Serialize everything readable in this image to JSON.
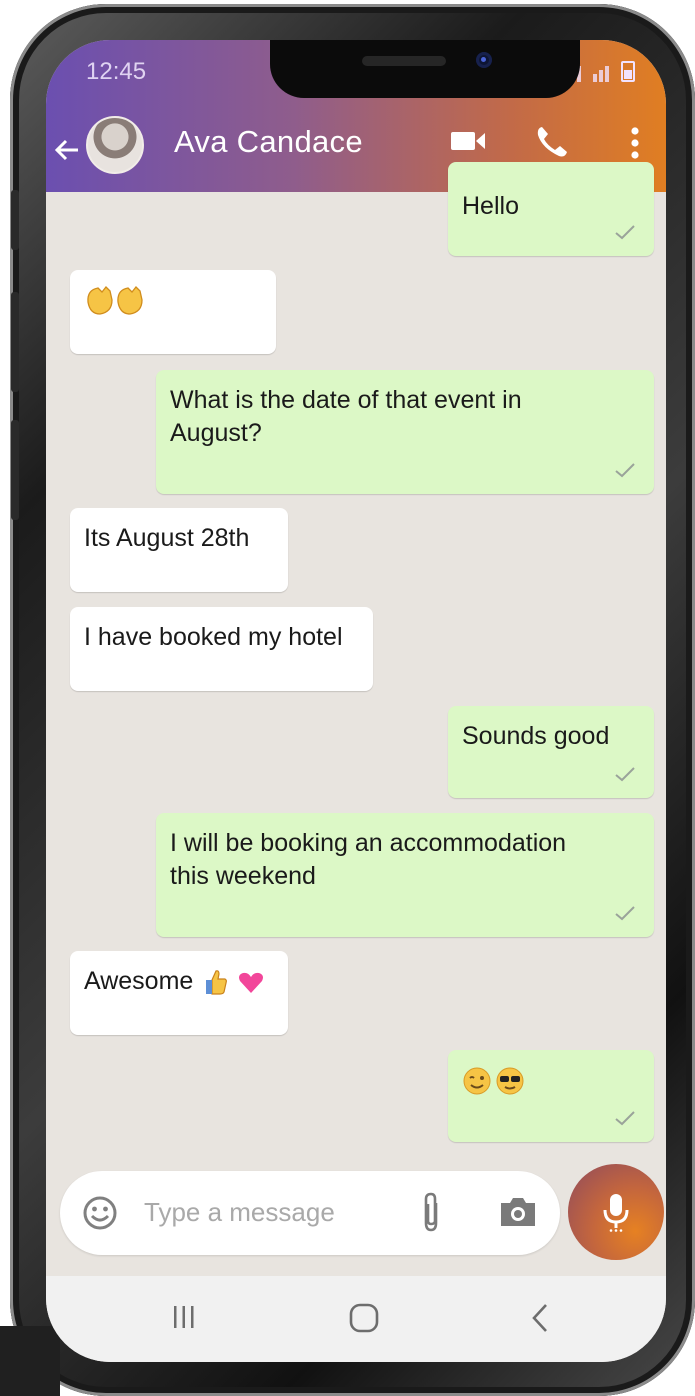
{
  "status_bar": {
    "time": "12:45"
  },
  "header": {
    "contact_name": "Ava Candace"
  },
  "messages": [
    {
      "dir": "out",
      "text": "Hello"
    },
    {
      "dir": "in",
      "text": ""
    },
    {
      "dir": "out",
      "text": "What is the date of that event in August?"
    },
    {
      "dir": "in",
      "text": "Its August 28th"
    },
    {
      "dir": "in",
      "text": "I have booked my hotel"
    },
    {
      "dir": "out",
      "text": "Sounds good"
    },
    {
      "dir": "out",
      "text": "I will be booking an accommodation this weekend"
    },
    {
      "dir": "in",
      "text": "Awesome"
    },
    {
      "dir": "out",
      "text": ""
    }
  ],
  "input": {
    "placeholder": "Type a message"
  },
  "colors": {
    "incoming_bubble": "#ffffff",
    "outgoing_bubble": "#dcf8c6",
    "chat_background": "#e8e4df",
    "header_gradient_start": "#6b4fb0",
    "header_gradient_end": "#e07e22"
  },
  "icons": {
    "header": [
      "back-arrow-icon",
      "video-call-icon",
      "phone-call-icon",
      "more-options-icon"
    ],
    "input": [
      "emoji-icon",
      "attach-icon",
      "camera-icon",
      "mic-icon"
    ],
    "nav": [
      "recent-apps-icon",
      "home-icon",
      "back-icon"
    ]
  }
}
